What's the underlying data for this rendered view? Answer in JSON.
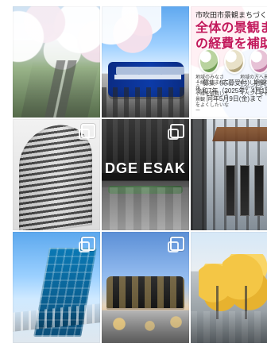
{
  "grid": {
    "items": [
      {
        "id": "tile-1",
        "type": "photo",
        "multi": false
      },
      {
        "id": "tile-2",
        "type": "photo",
        "multi": false
      },
      {
        "id": "tile-3",
        "type": "poster",
        "multi": false,
        "poster": {
          "line1": "市吹田市景観まちづくり活",
          "line2": "全体の景観まちづ",
          "line3": "の経費を補助しま",
          "mid1": "！募集（応募受付）期間！",
          "mid2": "令和7年（2025年）4月1日(火)～",
          "mid3": "同年5月9日(金)まで",
          "bottom_left": "地域のみなさ\nー緒に、まちに花\nや緑を植栽して景観\nをよくしたいなー",
          "bottom_right": "地域の方へ景観\nおいしいものを\nなかでもとられ\nイベントをやりた"
        }
      },
      {
        "id": "tile-4",
        "type": "photo",
        "multi": true
      },
      {
        "id": "tile-5",
        "type": "photo",
        "multi": true,
        "sign": "DGE ESAK"
      },
      {
        "id": "tile-6",
        "type": "photo",
        "multi": false
      },
      {
        "id": "tile-7",
        "type": "photo",
        "multi": true
      },
      {
        "id": "tile-8",
        "type": "photo",
        "multi": true
      },
      {
        "id": "tile-9",
        "type": "photo",
        "multi": false
      }
    ]
  }
}
